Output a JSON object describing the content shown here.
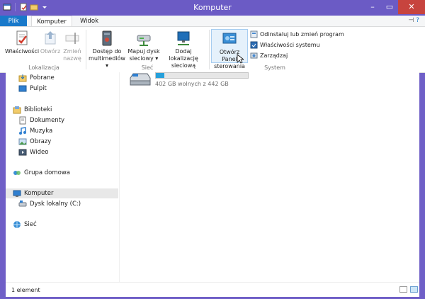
{
  "window": {
    "title": "Komputer",
    "accent": "#6b5bc5"
  },
  "tabs": {
    "file": "Plik",
    "computer": "Komputer",
    "view": "Widok"
  },
  "ribbon": {
    "groups": {
      "location": "Lokalizacja",
      "network": "Sieć",
      "system": "System"
    },
    "buttons": {
      "properties": "Właściwości",
      "open": "Otwórz",
      "rename_line1": "Zmień",
      "rename_line2": "nazwę",
      "media_line1": "Dostęp do",
      "media_line2": "multimediów ▾",
      "map_line1": "Mapuj dysk",
      "map_line2": "sieciowy ▾",
      "addloc_line1": "Dodaj lokalizację",
      "addloc_line2": "sieciową",
      "panel_line1": "Otwórz Panel",
      "panel_line2": "sterowania"
    },
    "small_buttons": {
      "uninstall": "Odinstaluj lub zmień program",
      "sysprops": "Właściwości systemu",
      "manage": "Zarządzaj"
    }
  },
  "nav": {
    "items": [
      {
        "label": "Pobrane"
      },
      {
        "label": "Pulpit"
      },
      {
        "label": "Biblioteki"
      },
      {
        "label": "Dokumenty"
      },
      {
        "label": "Muzyka"
      },
      {
        "label": "Obrazy"
      },
      {
        "label": "Wideo"
      },
      {
        "label": "Grupa domowa"
      },
      {
        "label": "Komputer"
      },
      {
        "label": "Dysk lokalny (C:)"
      },
      {
        "label": "Sieć"
      }
    ]
  },
  "drive": {
    "free_text": "402 GB wolnych z 442 GB",
    "used_fraction": 0.09
  },
  "status": {
    "count": "1 element"
  }
}
